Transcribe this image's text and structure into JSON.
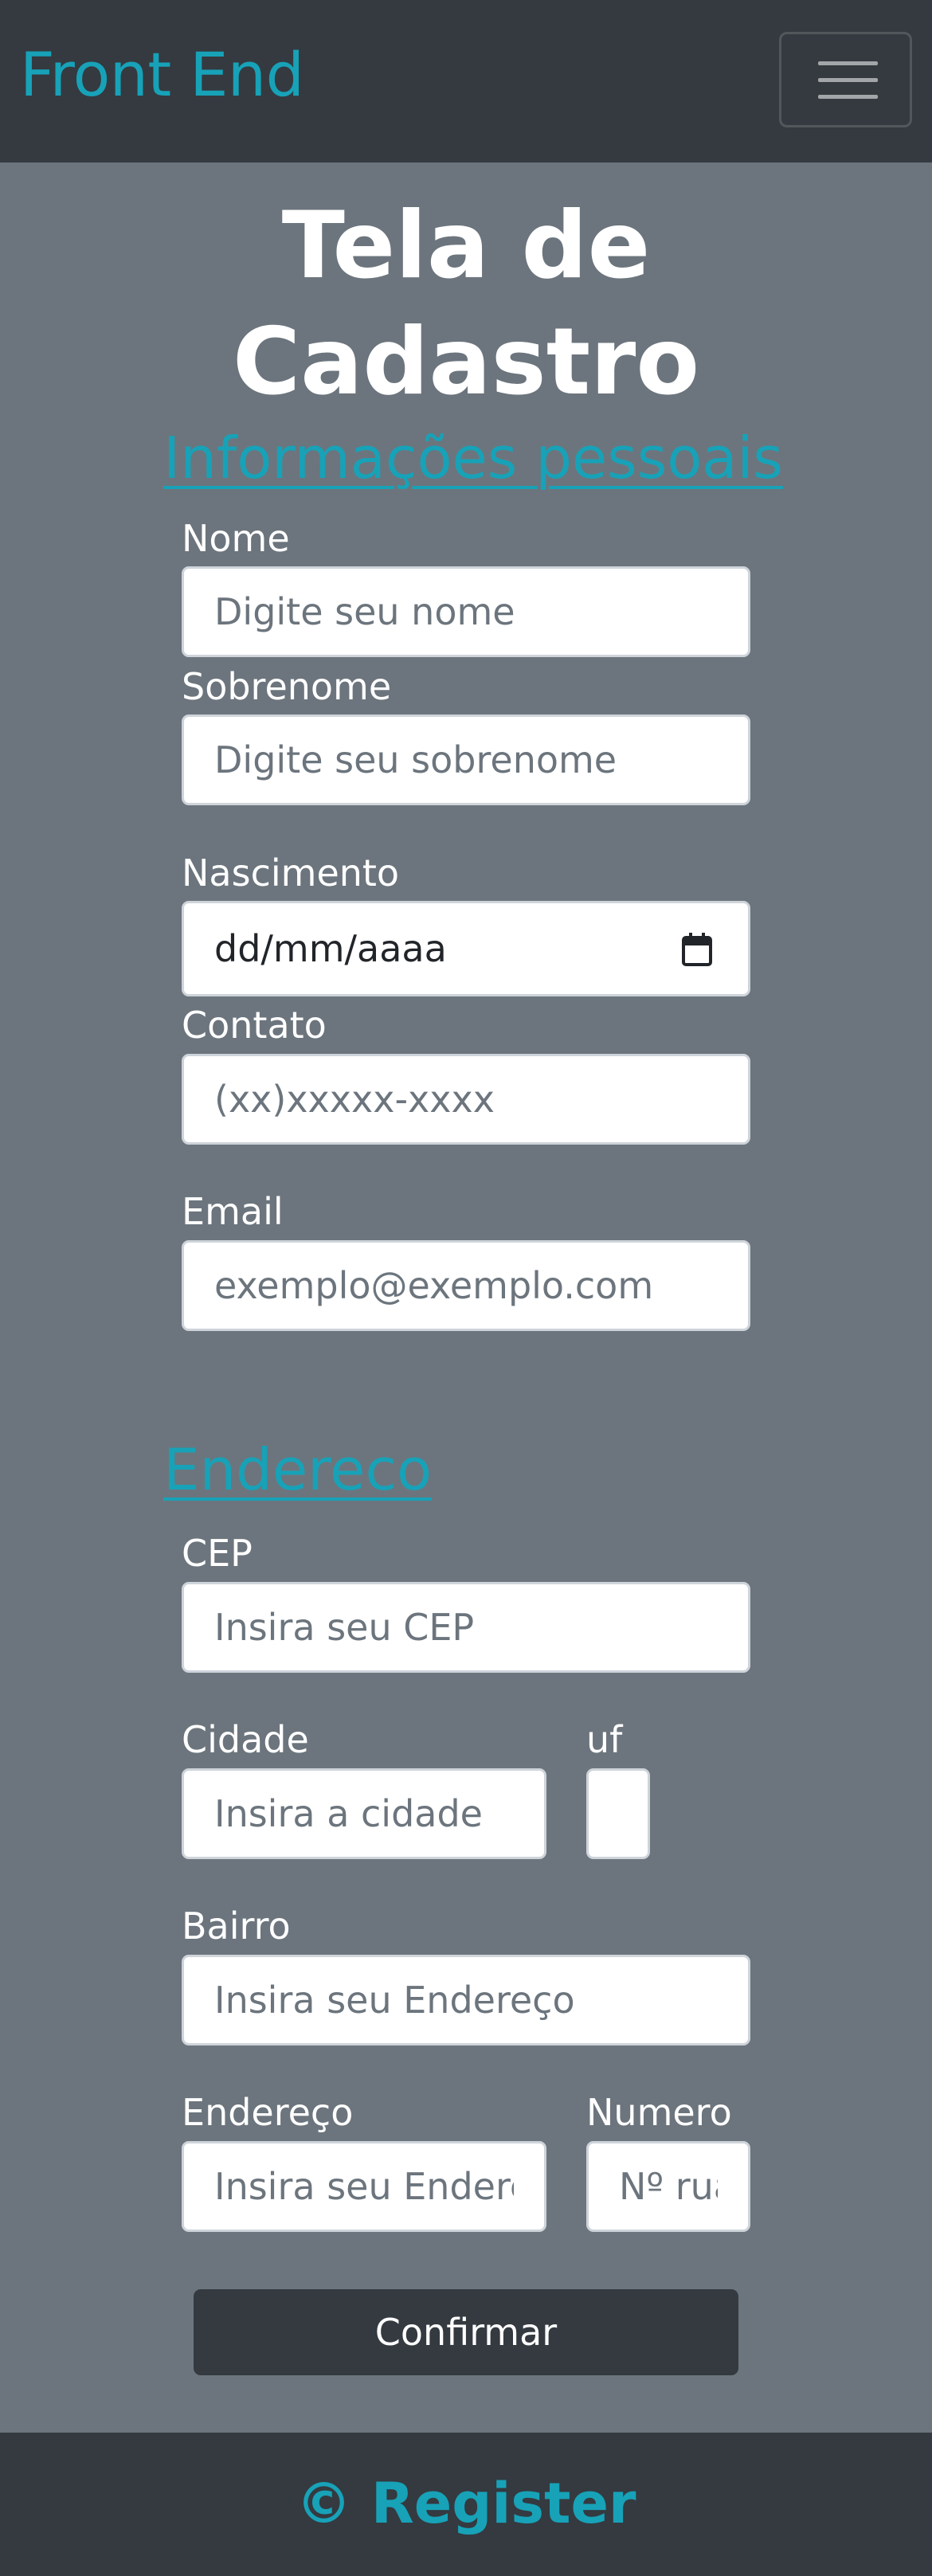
{
  "navbar": {
    "brand": "Front End",
    "toggler_icon": "hamburger-menu-icon"
  },
  "page": {
    "title_line1": "Tela de",
    "title_line2": "Cadastro"
  },
  "personal": {
    "heading": "Informações pessoais",
    "nome_label": "Nome",
    "nome_placeholder": "Digite seu nome",
    "sobrenome_label": "Sobrenome",
    "sobrenome_placeholder": "Digite seu sobrenome",
    "nascimento_label": "Nascimento",
    "nascimento_value": "dd/mm/aaaa",
    "calendar_icon": "calendar-icon",
    "contato_label": "Contato",
    "contato_placeholder": "(xx)xxxxx-xxxx",
    "email_label": "Email",
    "email_placeholder": "exemplo@exemplo.com"
  },
  "address": {
    "heading": "Endereco",
    "cep_label": "CEP",
    "cep_placeholder": "Insira seu CEP",
    "cidade_label": "Cidade",
    "cidade_placeholder": "Insira a cidade",
    "uf_label": "uf",
    "uf_value": "",
    "bairro_label": "Bairro",
    "bairro_placeholder": "Insira seu Endereço",
    "endereco_label": "Endereço",
    "endereco_placeholder": "Insira seu Endereço",
    "numero_label": "Numero",
    "numero_placeholder": "Nº rua"
  },
  "form": {
    "submit_label": "Confirmar"
  },
  "footer": {
    "text": "© Register"
  },
  "colors": {
    "accent": "#17a2b8",
    "navbar_bg": "#343a40",
    "page_bg": "#6c757d",
    "button_bg": "#343a40"
  }
}
